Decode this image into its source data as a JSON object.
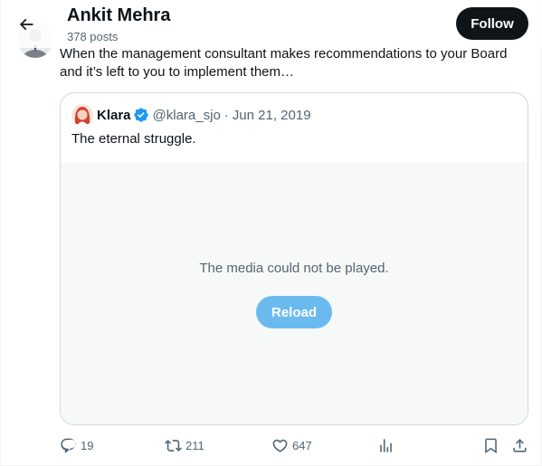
{
  "header": {
    "title": "Ankit Mehra",
    "posts_count": "378 posts",
    "follow_label": "Follow"
  },
  "tweet": {
    "text": "When the management consultant makes recommendations to your Board and it’s left to you to implement them…"
  },
  "quote": {
    "name": "Klara",
    "handle": "@klara_sjo",
    "separator": "·",
    "date": "Jun 21, 2019",
    "text": "The eternal struggle.",
    "media_error": "The media could not be played.",
    "reload_label": "Reload"
  },
  "actions": {
    "replies": "19",
    "reposts": "211",
    "likes": "647"
  },
  "icons": {
    "back": "arrow-left-icon",
    "verified": "verified-badge-icon",
    "reply": "reply-icon",
    "repost": "repost-icon",
    "like": "heart-icon",
    "views": "views-icon",
    "bookmark": "bookmark-icon",
    "share": "share-icon"
  },
  "colors": {
    "text_primary": "#0f1419",
    "text_secondary": "#536471",
    "verified_blue": "#1d9bf0",
    "follow_bg": "#0f1419",
    "media_bg": "#f7f9f9",
    "border": "#cfd9de"
  }
}
